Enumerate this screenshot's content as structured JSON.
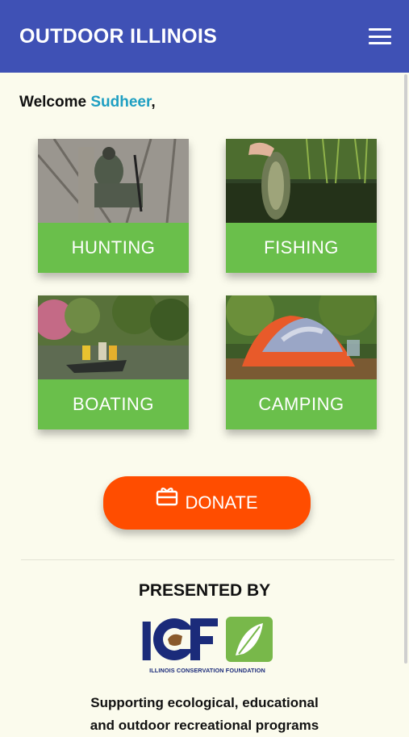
{
  "appbar": {
    "title": "OUTDOOR ILLINOIS",
    "menu_icon": "hamburger-menu-icon"
  },
  "welcome": {
    "greeting": "Welcome ",
    "username": "Sudheer",
    "punct": ","
  },
  "tiles": [
    {
      "label": "HUNTING",
      "image": "hunter-in-tree-stand"
    },
    {
      "label": "FISHING",
      "image": "hand-holding-bass"
    },
    {
      "label": "BOATING",
      "image": "boat-on-river"
    },
    {
      "label": "CAMPING",
      "image": "tent-in-forest"
    }
  ],
  "donate": {
    "label": "DONATE",
    "icon": "gift-card-icon"
  },
  "presented_by": "PRESENTED BY",
  "logo": {
    "letters": "ICF",
    "subtitle": "ILLINOIS CONSERVATION FOUNDATION"
  },
  "tagline": {
    "line1": "Supporting ecological, educational",
    "line2": "and outdoor recreational programs"
  },
  "colors": {
    "appbar": "#3f51b5",
    "tile_label": "#6abf4b",
    "donate": "#ff4d00",
    "username": "#1f9fc2",
    "background": "#fbfbed"
  }
}
